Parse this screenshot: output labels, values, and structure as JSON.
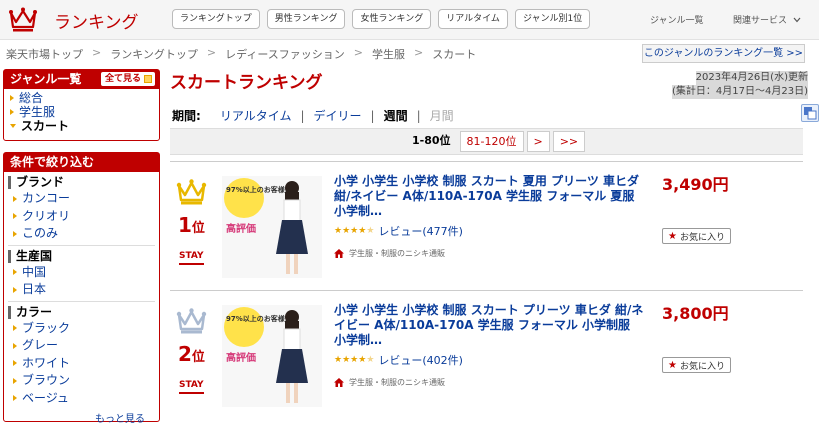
{
  "header": {
    "logo_text": "ランキング",
    "nav": [
      "ランキングトップ",
      "男性ランキング",
      "女性ランキング",
      "リアルタイム",
      "ジャンル別1位"
    ],
    "genre_list": "ジャンル一覧",
    "related": "関連サービス"
  },
  "breadcrumb": [
    "楽天市場トップ",
    "ランキングトップ",
    "レディースファッション",
    "学生服",
    "スカート"
  ],
  "genre_list_button": "このジャンルのランキング一覧 >>",
  "sidebar": {
    "genre_title": "ジャンル一覧",
    "see_all": "全て見る",
    "genres": [
      "総合",
      "学生服",
      "スカート"
    ],
    "filter_title": "条件で絞り込む",
    "groups": [
      {
        "title": "ブランド",
        "items": [
          "カンコー",
          "クリオリ",
          "このみ"
        ]
      },
      {
        "title": "生産国",
        "items": [
          "中国",
          "日本"
        ]
      },
      {
        "title": "カラー",
        "items": [
          "ブラック",
          "グレー",
          "ホワイト",
          "ブラウン",
          "ベージュ"
        ]
      }
    ],
    "more": "もっと見る"
  },
  "main": {
    "title": "スカートランキング",
    "updated": "2023年4月26日(水)更新",
    "range": "(集計日：4月17日〜4月23日)",
    "period_label": "期間:",
    "periods": [
      "リアルタイム",
      "デイリー",
      "週間",
      "月間"
    ],
    "pages": [
      "1-80位",
      "81-120位",
      ">",
      ">>"
    ]
  },
  "items": [
    {
      "rank": "1",
      "rank_suffix": "位",
      "status": "STAY",
      "title": "小学 小学生 小学校 制服 スカート 夏用 プリーツ 車ヒダ 紺/ネイビー A体/110A-170A 学生服 フォーマル 夏服 小学制…",
      "review": "レビュー(477件)",
      "shop": "学生服・制服のニシキ通販",
      "price": "3,490円",
      "fav": "お気に入り",
      "thumb_badge": "97%以上のお客様から",
      "thumb_acclaim": "高評価",
      "crown_color": "#e8b800"
    },
    {
      "rank": "2",
      "rank_suffix": "位",
      "status": "STAY",
      "title": "小学 小学生 小学校 制服 スカート プリーツ 車ヒダ 紺/ネイビー A体/110A-170A 学生服 フォーマル 小学制服 小学制…",
      "review": "レビュー(402件)",
      "shop": "学生服・制服のニシキ通販",
      "price": "3,800円",
      "fav": "お気に入り",
      "thumb_badge": "97%以上のお客様から",
      "thumb_acclaim": "高評価",
      "crown_color": "#a9b9d0"
    }
  ]
}
